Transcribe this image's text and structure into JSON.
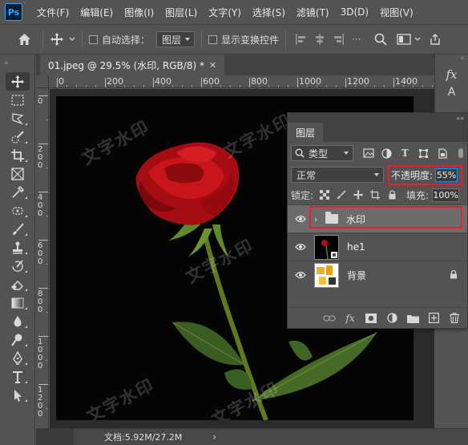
{
  "app": {
    "logo": "Ps"
  },
  "menu": [
    "文件(F)",
    "编辑(E)",
    "图像(I)",
    "图层(L)",
    "文字(Y)",
    "选择(S)",
    "滤镜(T)",
    "3D(D)",
    "视图(V)"
  ],
  "options": {
    "auto_select_label": "自动选择：",
    "auto_select_target": "图层",
    "show_transform_label": "显示变换控件"
  },
  "document": {
    "tab_title": "01.jpeg @ 29.5% (水印, RGB/8) *",
    "watermark_text": "文字水印",
    "status_info": "文档:5.92M/27.2M"
  },
  "rulers": {
    "h_labels": [
      "0",
      "200",
      "400",
      "600",
      "800",
      "1000",
      "1200",
      "1400"
    ],
    "v_labels": [
      "0",
      "200",
      "400",
      "600",
      "800",
      "1000",
      "1200"
    ]
  },
  "layers_panel": {
    "tab_label": "图层",
    "kind_filter": "类型",
    "blend_mode": "正常",
    "opacity_label": "不透明度:",
    "opacity_value": "55%",
    "lock_label": "锁定:",
    "fill_label": "填充:",
    "fill_value": "100%",
    "layers": [
      {
        "name": "水印",
        "type": "group",
        "visible": true,
        "selected": true
      },
      {
        "name": "he1",
        "type": "smart-object",
        "visible": true,
        "selected": false
      },
      {
        "name": "背景",
        "type": "background",
        "visible": true,
        "locked": true,
        "selected": false
      }
    ]
  },
  "colors": {
    "ui_bg": "#535353",
    "highlight_red": "#e8202a",
    "accent_blue": "#1f8ef0"
  }
}
